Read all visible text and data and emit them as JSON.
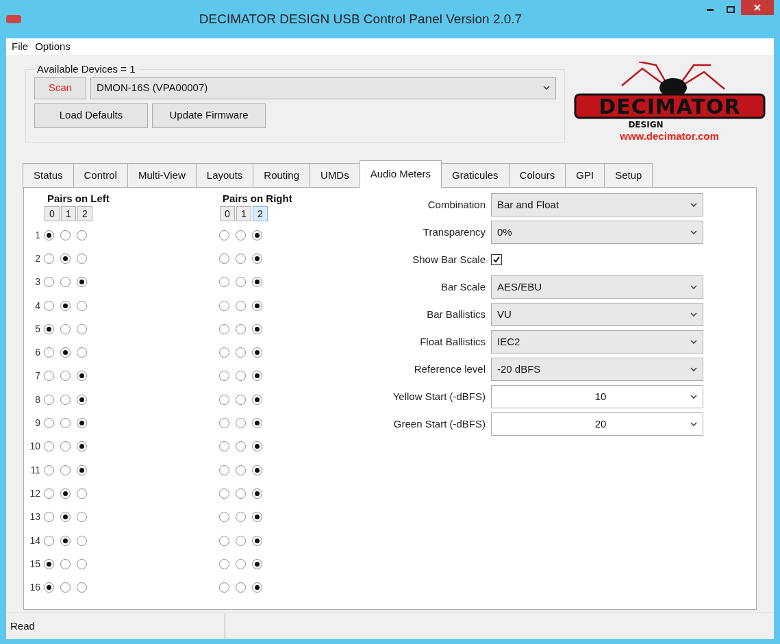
{
  "window": {
    "title": "DECIMATOR DESIGN USB Control Panel Version 2.0.7"
  },
  "menu": [
    "File",
    "Options"
  ],
  "devices": {
    "legend": "Available Devices = 1",
    "scan": "Scan",
    "device": "DMON-16S (VPA00007)",
    "buttons": [
      "Load Defaults",
      "Update Firmware"
    ]
  },
  "logo": {
    "word": "DECIMATOR",
    "sub": "DESIGN",
    "url": "www.decimator.com"
  },
  "tabs": [
    {
      "label": "Status",
      "selected": false
    },
    {
      "label": "Control",
      "selected": false
    },
    {
      "label": "Multi-View",
      "selected": false
    },
    {
      "label": "Layouts",
      "selected": false
    },
    {
      "label": "Routing",
      "selected": false
    },
    {
      "label": "UMDs",
      "selected": false
    },
    {
      "label": "Audio Meters",
      "selected": true
    },
    {
      "label": "Graticules",
      "selected": false
    },
    {
      "label": "Colours",
      "selected": false
    },
    {
      "label": "GPI",
      "selected": false
    },
    {
      "label": "Setup",
      "selected": false
    }
  ],
  "pairs_left": {
    "title": "Pairs on Left",
    "headers": [
      {
        "label": "0",
        "selected": false
      },
      {
        "label": "1",
        "selected": false
      },
      {
        "label": "2",
        "selected": false
      }
    ]
  },
  "pairs_right": {
    "title": "Pairs on Right",
    "headers": [
      {
        "label": "0",
        "selected": false
      },
      {
        "label": "1",
        "selected": false
      },
      {
        "label": "2",
        "selected": true
      }
    ]
  },
  "rows": [
    {
      "label": "1",
      "left": [
        {
          "selected": true
        },
        {
          "selected": false
        },
        {
          "selected": false
        }
      ],
      "right": [
        {
          "selected": false
        },
        {
          "selected": false
        },
        {
          "selected": true
        }
      ]
    },
    {
      "label": "2",
      "left": [
        {
          "selected": false
        },
        {
          "selected": true
        },
        {
          "selected": false
        }
      ],
      "right": [
        {
          "selected": false
        },
        {
          "selected": false
        },
        {
          "selected": true
        }
      ]
    },
    {
      "label": "3",
      "left": [
        {
          "selected": false
        },
        {
          "selected": false
        },
        {
          "selected": true
        }
      ],
      "right": [
        {
          "selected": false
        },
        {
          "selected": false
        },
        {
          "selected": true
        }
      ]
    },
    {
      "label": "4",
      "left": [
        {
          "selected": false
        },
        {
          "selected": true
        },
        {
          "selected": false
        }
      ],
      "right": [
        {
          "selected": false
        },
        {
          "selected": false
        },
        {
          "selected": true
        }
      ]
    },
    {
      "label": "5",
      "left": [
        {
          "selected": true
        },
        {
          "selected": false
        },
        {
          "selected": false
        }
      ],
      "right": [
        {
          "selected": false
        },
        {
          "selected": false
        },
        {
          "selected": true
        }
      ]
    },
    {
      "label": "6",
      "left": [
        {
          "selected": false
        },
        {
          "selected": true
        },
        {
          "selected": false
        }
      ],
      "right": [
        {
          "selected": false
        },
        {
          "selected": false
        },
        {
          "selected": true
        }
      ]
    },
    {
      "label": "7",
      "left": [
        {
          "selected": false
        },
        {
          "selected": false
        },
        {
          "selected": true
        }
      ],
      "right": [
        {
          "selected": false
        },
        {
          "selected": false
        },
        {
          "selected": true
        }
      ]
    },
    {
      "label": "8",
      "left": [
        {
          "selected": false
        },
        {
          "selected": false
        },
        {
          "selected": true
        }
      ],
      "right": [
        {
          "selected": false
        },
        {
          "selected": false
        },
        {
          "selected": true
        }
      ]
    },
    {
      "label": "9",
      "left": [
        {
          "selected": false
        },
        {
          "selected": false
        },
        {
          "selected": true
        }
      ],
      "right": [
        {
          "selected": false
        },
        {
          "selected": false
        },
        {
          "selected": true
        }
      ]
    },
    {
      "label": "10",
      "left": [
        {
          "selected": false
        },
        {
          "selected": false
        },
        {
          "selected": true
        }
      ],
      "right": [
        {
          "selected": false
        },
        {
          "selected": false
        },
        {
          "selected": true
        }
      ]
    },
    {
      "label": "11",
      "left": [
        {
          "selected": false
        },
        {
          "selected": false
        },
        {
          "selected": true
        }
      ],
      "right": [
        {
          "selected": false
        },
        {
          "selected": false
        },
        {
          "selected": true
        }
      ]
    },
    {
      "label": "12",
      "left": [
        {
          "selected": false
        },
        {
          "selected": true
        },
        {
          "selected": false
        }
      ],
      "right": [
        {
          "selected": false
        },
        {
          "selected": false
        },
        {
          "selected": true
        }
      ]
    },
    {
      "label": "13",
      "left": [
        {
          "selected": false
        },
        {
          "selected": true
        },
        {
          "selected": false
        }
      ],
      "right": [
        {
          "selected": false
        },
        {
          "selected": false
        },
        {
          "selected": true
        }
      ]
    },
    {
      "label": "14",
      "left": [
        {
          "selected": false
        },
        {
          "selected": true
        },
        {
          "selected": false
        }
      ],
      "right": [
        {
          "selected": false
        },
        {
          "selected": false
        },
        {
          "selected": true
        }
      ]
    },
    {
      "label": "15",
      "left": [
        {
          "selected": true
        },
        {
          "selected": false
        },
        {
          "selected": false
        }
      ],
      "right": [
        {
          "selected": false
        },
        {
          "selected": false
        },
        {
          "selected": true
        }
      ]
    },
    {
      "label": "16",
      "left": [
        {
          "selected": true
        },
        {
          "selected": false
        },
        {
          "selected": false
        }
      ],
      "right": [
        {
          "selected": false
        },
        {
          "selected": false
        },
        {
          "selected": true
        }
      ]
    }
  ],
  "settings": [
    {
      "kind": "dropdown",
      "label": "Combination",
      "value": "Bar and Float"
    },
    {
      "kind": "dropdown",
      "label": "Transparency",
      "value": "0%"
    },
    {
      "kind": "checkbox",
      "label": "Show Bar Scale",
      "checked": true
    },
    {
      "kind": "dropdown",
      "label": "Bar Scale",
      "value": "AES/EBU"
    },
    {
      "kind": "dropdown",
      "label": "Bar Ballistics",
      "value": "VU"
    },
    {
      "kind": "dropdown",
      "label": "Float Ballistics",
      "value": "IEC2"
    },
    {
      "kind": "dropdown",
      "label": "Reference level",
      "value": "-20 dBFS"
    },
    {
      "kind": "editable",
      "label": "Yellow Start (-dBFS)",
      "value": "10"
    },
    {
      "kind": "editable",
      "label": "Green Start (-dBFS)",
      "value": "20"
    }
  ],
  "status_bar": {
    "text": "Read"
  }
}
